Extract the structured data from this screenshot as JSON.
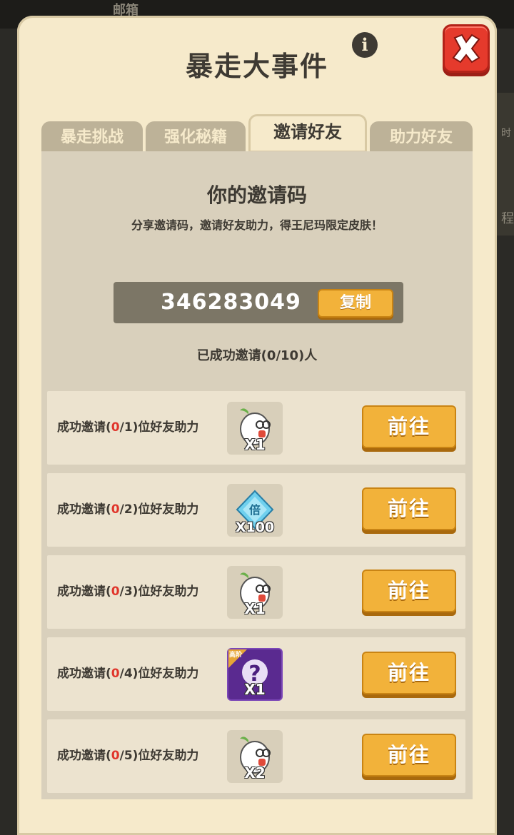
{
  "background": {
    "mail_label": "邮箱",
    "side_label_1": "时",
    "side_label_2": "程"
  },
  "panel": {
    "title": "暴走大事件",
    "info_icon": "i"
  },
  "tabs": [
    {
      "label": "暴走挑战",
      "active": false
    },
    {
      "label": "强化秘籍",
      "active": false
    },
    {
      "label": "邀请好友",
      "active": true
    },
    {
      "label": "助力好友",
      "active": false
    }
  ],
  "invite": {
    "title": "你的邀请码",
    "subtitle": "分享邀请码，邀请好友助力，得王尼玛限定皮肤！",
    "code": "346283049",
    "copy_label": "复制",
    "invited_count": "已成功邀请(0/10)人"
  },
  "tasks": [
    {
      "prefix": "成功邀请(",
      "current": "0",
      "suffix": "/1)位好友助力",
      "reward_icon": "egghead-character-icon",
      "reward_qty": "X1",
      "button": "前往"
    },
    {
      "prefix": "成功邀请(",
      "current": "0",
      "suffix": "/2)位好友助力",
      "reward_icon": "double-multiplier-diamond-icon",
      "reward_qty": "X100",
      "button": "前往"
    },
    {
      "prefix": "成功邀请(",
      "current": "0",
      "suffix": "/3)位好友助力",
      "reward_icon": "egghead-character-icon",
      "reward_qty": "X1",
      "button": "前往"
    },
    {
      "prefix": "成功邀请(",
      "current": "0",
      "suffix": "/4)位好友助力",
      "reward_icon": "mystery-box-icon",
      "reward_qty": "X1",
      "reward_tag": "高阶",
      "button": "前往"
    },
    {
      "prefix": "成功邀请(",
      "current": "0",
      "suffix": "/5)位好友助力",
      "reward_icon": "egghead-character-icon",
      "reward_qty": "X2",
      "button": "前往"
    }
  ],
  "colors": {
    "panel_bg": "#f6eacb",
    "content_bg": "#d9d0bc",
    "row_bg": "#ece3cf",
    "button_orange": "#f2b23a",
    "close_red": "#e53a2c",
    "text_dark": "#3e3a33",
    "progress_red": "#e0352b"
  }
}
